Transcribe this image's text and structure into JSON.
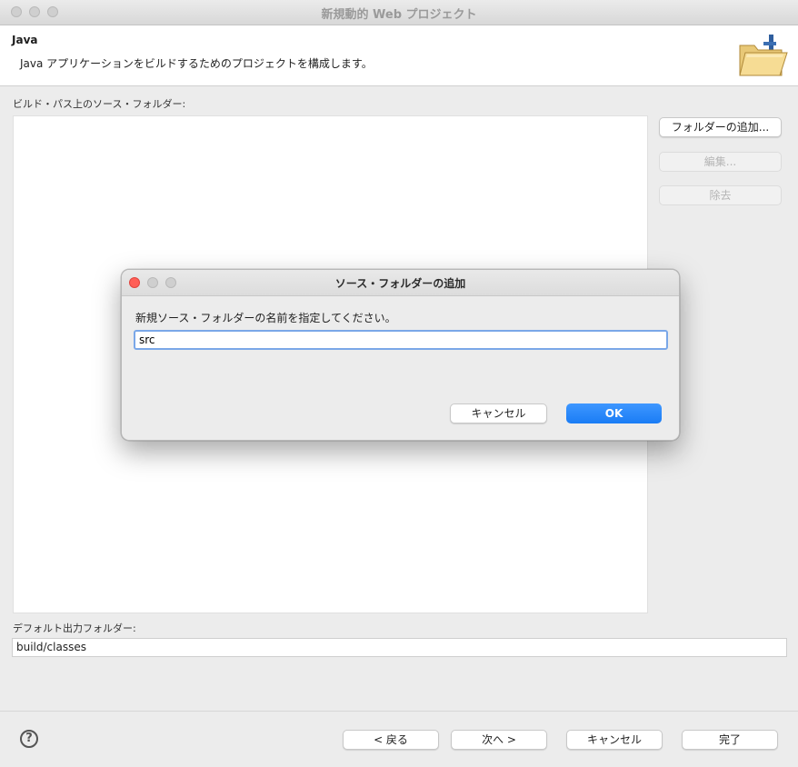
{
  "window": {
    "title": "新規動的 Web プロジェクト"
  },
  "header": {
    "title": "Java",
    "description": "Java アプリケーションをビルドするためのプロジェクトを構成します。",
    "icon": "folder-open-icon"
  },
  "source": {
    "label": "ビルド・パス上のソース・フォルダー:",
    "items": []
  },
  "side_buttons": {
    "add": "フォルダーの追加...",
    "edit": "編集...",
    "remove": "除去"
  },
  "output": {
    "label": "デフォルト出力フォルダー:",
    "value": "build/classes"
  },
  "footer": {
    "help_icon": "help-icon",
    "help_glyph": "?",
    "back": "< 戻る",
    "next": "次へ >",
    "cancel": "キャンセル",
    "finish": "完了"
  },
  "dialog": {
    "title": "ソース・フォルダーの追加",
    "prompt": "新規ソース・フォルダーの名前を指定してください。",
    "input_value": "src",
    "cancel": "キャンセル",
    "ok": "OK"
  },
  "colors": {
    "accent": "#1a7cf5",
    "focus_ring": "#7aa7e8",
    "close_red": "#ff5f57"
  }
}
